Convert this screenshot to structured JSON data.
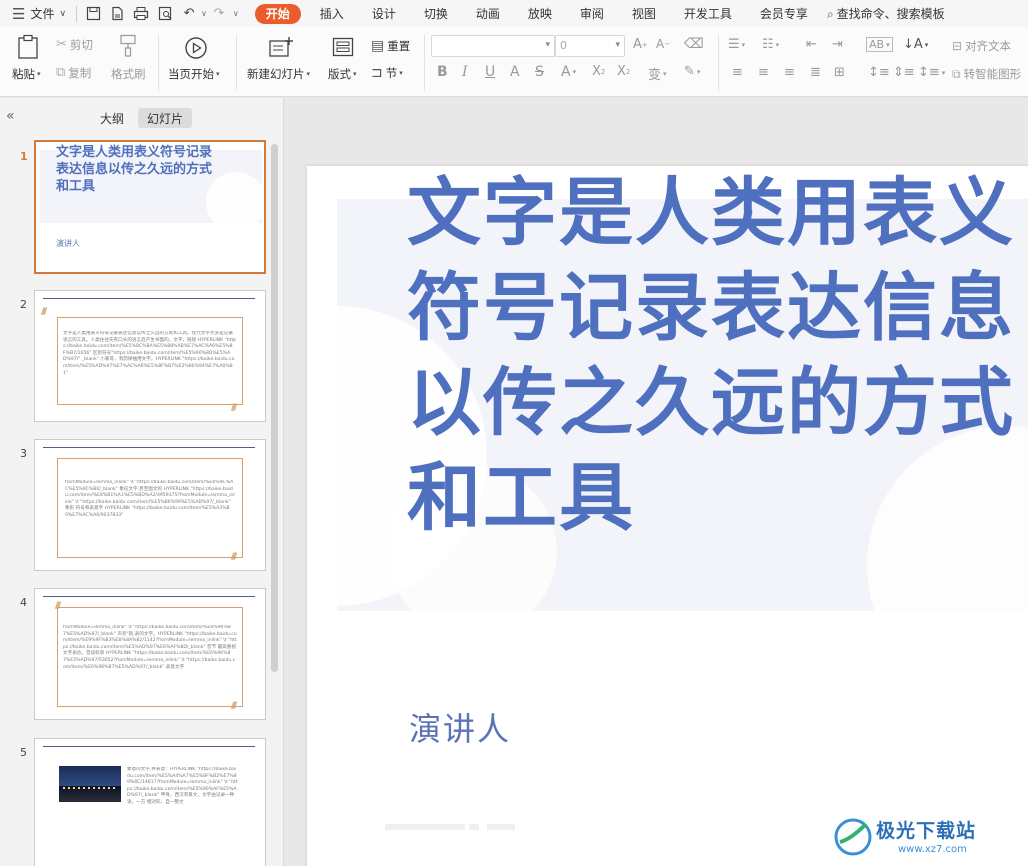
{
  "menu": {
    "file_label": "文件",
    "tabs": [
      "开始",
      "插入",
      "设计",
      "切换",
      "动画",
      "放映",
      "审阅",
      "视图",
      "开发工具",
      "会员专享"
    ],
    "active_tab": "开始",
    "search_placeholder": "查找命令、搜索模板"
  },
  "ribbon": {
    "paste": "粘贴",
    "cut": "剪切",
    "copy": "复制",
    "format_painter": "格式刷",
    "play_from_current": "当页开始",
    "new_slide": "新建幻灯片",
    "layout": "版式",
    "section": "节",
    "reset": "重置",
    "font_size_value": "0",
    "align_text": "对齐文本",
    "smartart": "转智能图形"
  },
  "panel": {
    "tabs": [
      "大纲",
      "幻灯片"
    ],
    "active_tab": "幻灯片"
  },
  "slides": [
    {
      "num": "1",
      "title": "文字是人类用表义符号记录表达信息以传之久远的方式和工具",
      "speaker": "演讲人"
    },
    {
      "num": "2",
      "text": "文字是人类用表义符号记录表达信息以传之久远的方式和工具。现代文字大多是记录语言的工具。人类往往先有口头的语言后产生书面的。文字，链接 HYPERLINK \"https://baike.baidu.com/item/%E5%8C%BA%E5%88%AB%E7%AC%A6%E5%8F%B7/1656\" 区别符号\"https://baike.baidu.com/item/%E5%90%8D%E5%AD%97/\" _blank\" 小篆等，有韵律抽用文字。HYPERLINK \"https://baike.baidu.com/item/%E5%AD%97%E7%AC%A6%E5%8F%B7%E2%80%94%E7%A0%81\""
    },
    {
      "num": "3",
      "text": "fromModule=lemma_inlink\" \\t \"https://baike.baidu.com/item/%E6%9C%AC%E5%9C%B0/_blank\" 象征文字,甚至图文的 HYPERLINK \"https://baike.baidu.com/item/%E8%B1%A1%E5%BD%A2/4959375?fromModule=lemma_inlink\" \\t \"https://baike.baidu.com/item/%E5%86%99%E5%AD%97/_blank\" 象形 符号和表意字 HYPERLINK \"https://baike.baidu.com/item/%E5%A3%B0%E7%AC%A6/9037833\""
    },
    {
      "num": "4",
      "text": "fromModule=lemma_inlink\" \\t \"https://baike.baidu.com/item/%E6%96%87%E5%AD%97/_blank\" 声旁\"就,表的文字。HYPERLINK \"https://baike.baidu.com/item/%E9%9F%B3%E8%8A%82/1142?fromModule=lemma_inlink\" \\t \"https://baike.baidu.com/item/%E5%AD%97%E6%AF%8D/_blank\" 音节 最高重视文字表达。音段标单 HYPERLINK \"https://baike.baidu.com/item/%E6%96%87%E5%AD%97/53052?fromModule=lemma_inlink\" \\t \"https://baike.baidu.com/item/%E6%96%87%E5%AD%97/_blank\" 表意文字"
    },
    {
      "num": "5",
      "text": "象意的文字,并表意：HYPERLINK \"https://baike.baidu.com/item/%E5%A4%A7%E5%8F%B2%E7%89%8C/14617?fromModule=lemma_inlink\" \\t \"https://baike.baidu.com/item/%E5%90%AF%E5%AD%97/_blank\" 甲骨，西汉有篆文，文字由记录一种语，一方 相对形，自一整文"
    }
  ],
  "watermark": {
    "brand": "极光下载站",
    "url": "www.xz7.com"
  }
}
